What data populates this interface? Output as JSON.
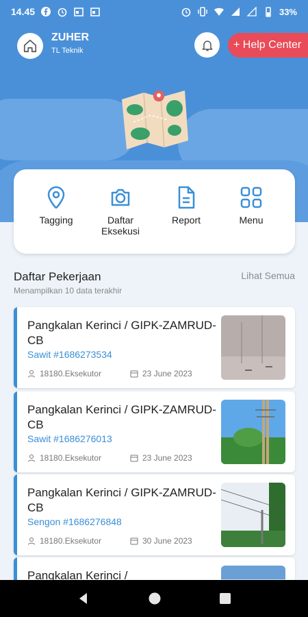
{
  "status_bar": {
    "time": "14.45",
    "battery": "33%"
  },
  "header": {
    "user_name": "ZUHER",
    "user_role": "TL Teknik",
    "help_label": "+ Help Center"
  },
  "menu": {
    "items": [
      {
        "label": "Tagging",
        "icon": "location-pin-icon"
      },
      {
        "label": "Daftar Eksekusi",
        "icon": "camera-icon"
      },
      {
        "label": "Report",
        "icon": "document-icon"
      },
      {
        "label": "Menu",
        "icon": "grid-icon"
      }
    ]
  },
  "list": {
    "title": "Daftar Pekerjaan",
    "subtitle": "Menampilkan 10 data terakhir",
    "see_all": "Lihat Semua",
    "jobs": [
      {
        "title": "Pangkalan Kerinci / GIPK-ZAMRUD-CB",
        "code": "Sawit #1686273534",
        "executor": "18180.Eksekutor",
        "date": "23 June 2023"
      },
      {
        "title": "Pangkalan Kerinci / GIPK-ZAMRUD-CB",
        "code": "Sawit #1686276013",
        "executor": "18180.Eksekutor",
        "date": "23 June 2023"
      },
      {
        "title": "Pangkalan Kerinci / GIPK-ZAMRUD-CB",
        "code": "Sengon #1686276848",
        "executor": "18180.Eksekutor",
        "date": "30 June 2023"
      },
      {
        "title": "Pangkalan Kerinci /",
        "code": "",
        "executor": "",
        "date": ""
      }
    ]
  },
  "colors": {
    "primary": "#4a90d9",
    "accent": "#3a8fd6",
    "help": "#e94b58"
  }
}
